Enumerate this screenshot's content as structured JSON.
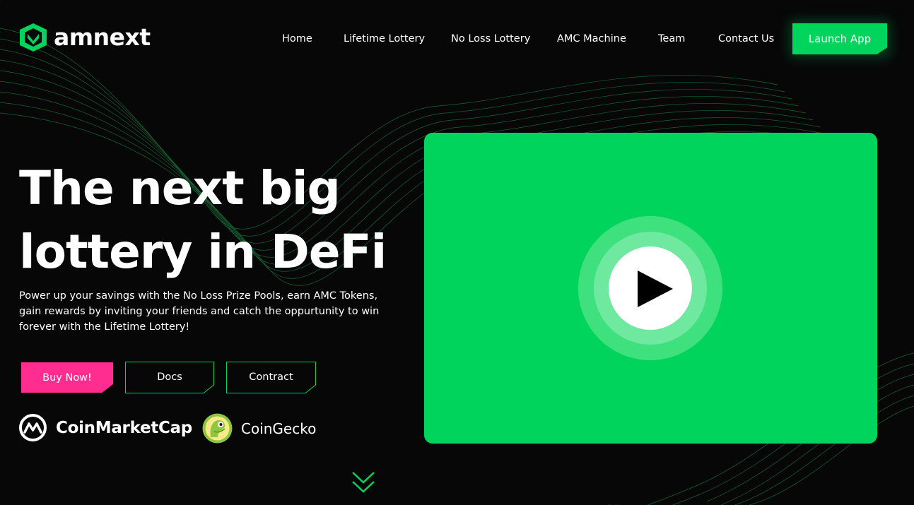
{
  "brand": {
    "name": "amnext"
  },
  "nav": {
    "items": [
      {
        "label": "Home"
      },
      {
        "label": "Lifetime Lottery"
      },
      {
        "label": "No Loss Lottery"
      },
      {
        "label": "AMC Machine"
      },
      {
        "label": "Team"
      },
      {
        "label": "Contact Us"
      }
    ],
    "cta": "Launch App"
  },
  "hero": {
    "title_line1": "The next big",
    "title_line2": "lottery in DeFi",
    "description": "Power up your savings with the No Loss Prize Pools, earn AMC Tokens, gain rewards by inviting your friends and catch the oppurtunity to win forever with the Lifetime Lottery!",
    "buttons": {
      "buy": "Buy Now!",
      "docs": "Docs",
      "contract": "Contract"
    }
  },
  "partners": [
    {
      "name": "CoinMarketCap",
      "icon": "coinmarketcap-icon"
    },
    {
      "name": "CoinGecko",
      "icon": "coingecko-icon"
    }
  ],
  "video": {
    "icon": "play-icon"
  },
  "scroll": {
    "icon": "double-chevron-down-icon"
  },
  "colors": {
    "background": "#070708",
    "accent": "#00d45c",
    "buy": "#ff2d8f",
    "text": "#ffffff"
  }
}
